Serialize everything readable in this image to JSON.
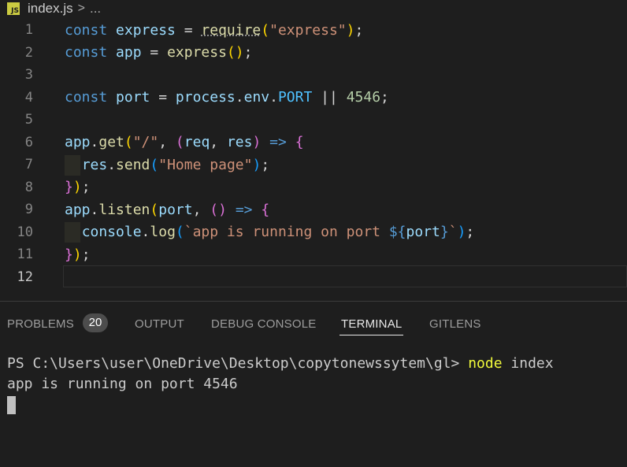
{
  "breadcrumb": {
    "file_icon": "JS",
    "filename": "index.js",
    "separator": ">",
    "more": "..."
  },
  "editor": {
    "line_numbers": [
      "1",
      "2",
      "3",
      "4",
      "5",
      "6",
      "7",
      "8",
      "9",
      "10",
      "11",
      "12"
    ],
    "active_line": "12",
    "lines": [
      [
        [
          "kw",
          "const"
        ],
        [
          "op",
          " "
        ],
        [
          "var",
          "express"
        ],
        [
          "op",
          " = "
        ],
        [
          "fn sq",
          "require"
        ],
        [
          "p1",
          "("
        ],
        [
          "str",
          "\"express\""
        ],
        [
          "p1",
          ")"
        ],
        [
          "op",
          ";"
        ]
      ],
      [
        [
          "kw",
          "const"
        ],
        [
          "op",
          " "
        ],
        [
          "var",
          "app"
        ],
        [
          "op",
          " = "
        ],
        [
          "fn",
          "express"
        ],
        [
          "p1",
          "()"
        ],
        [
          "op",
          ";"
        ]
      ],
      [],
      [
        [
          "kw",
          "const"
        ],
        [
          "op",
          " "
        ],
        [
          "var",
          "port"
        ],
        [
          "op",
          " = "
        ],
        [
          "var",
          "process"
        ],
        [
          "op",
          "."
        ],
        [
          "var",
          "env"
        ],
        [
          "op",
          "."
        ],
        [
          "const",
          "PORT"
        ],
        [
          "op",
          " || "
        ],
        [
          "num",
          "4546"
        ],
        [
          "op",
          ";"
        ]
      ],
      [],
      [
        [
          "var",
          "app"
        ],
        [
          "op",
          "."
        ],
        [
          "fn",
          "get"
        ],
        [
          "p1",
          "("
        ],
        [
          "str",
          "\"/\""
        ],
        [
          "op",
          ", "
        ],
        [
          "p2",
          "("
        ],
        [
          "var",
          "req"
        ],
        [
          "op",
          ", "
        ],
        [
          "var",
          "res"
        ],
        [
          "p2",
          ")"
        ],
        [
          "op",
          " "
        ],
        [
          "kw",
          "=>"
        ],
        [
          "op",
          " "
        ],
        [
          "p2",
          "{"
        ]
      ],
      [
        [
          "op",
          "  "
        ],
        [
          "var",
          "res"
        ],
        [
          "op",
          "."
        ],
        [
          "fn",
          "send"
        ],
        [
          "p3",
          "("
        ],
        [
          "str",
          "\"Home page\""
        ],
        [
          "p3",
          ")"
        ],
        [
          "op",
          ";"
        ]
      ],
      [
        [
          "p2",
          "}"
        ],
        [
          "p1",
          ")"
        ],
        [
          "op",
          ";"
        ]
      ],
      [
        [
          "var",
          "app"
        ],
        [
          "op",
          "."
        ],
        [
          "fn",
          "listen"
        ],
        [
          "p1",
          "("
        ],
        [
          "var",
          "port"
        ],
        [
          "op",
          ", "
        ],
        [
          "p2",
          "()"
        ],
        [
          "op",
          " "
        ],
        [
          "kw",
          "=>"
        ],
        [
          "op",
          " "
        ],
        [
          "p2",
          "{"
        ]
      ],
      [
        [
          "op",
          "  "
        ],
        [
          "var",
          "console"
        ],
        [
          "op",
          "."
        ],
        [
          "fn",
          "log"
        ],
        [
          "p3",
          "("
        ],
        [
          "str",
          "`app is running on port "
        ],
        [
          "kw",
          "${"
        ],
        [
          "var",
          "port"
        ],
        [
          "kw",
          "}"
        ],
        [
          "str",
          "`"
        ],
        [
          "p3",
          ")"
        ],
        [
          "op",
          ";"
        ]
      ],
      [
        [
          "p2",
          "}"
        ],
        [
          "p1",
          ")"
        ],
        [
          "op",
          ";"
        ]
      ],
      []
    ]
  },
  "panel": {
    "tabs": [
      {
        "label": "PROBLEMS",
        "active": false
      },
      {
        "label": "OUTPUT",
        "active": false
      },
      {
        "label": "DEBUG CONSOLE",
        "active": false
      },
      {
        "label": "TERMINAL",
        "active": true
      },
      {
        "label": "GITLENS",
        "active": false
      }
    ],
    "problems_count": "20"
  },
  "terminal": {
    "prompt": "PS C:\\Users\\user\\OneDrive\\Desktop\\copytonewssytem\\gl> ",
    "command": "node",
    "args": " index",
    "output": "app is running on port 4546"
  }
}
